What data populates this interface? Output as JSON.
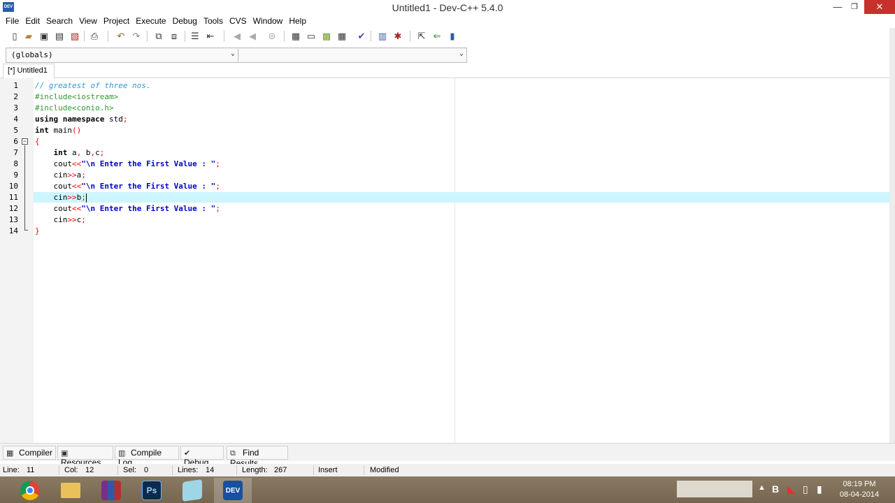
{
  "window": {
    "title": "Untitled1 - Dev-C++ 5.4.0",
    "minimize": "—",
    "maximize": "❐",
    "close": "✕",
    "app_icon_text": "DEV"
  },
  "menu": [
    "File",
    "Edit",
    "Search",
    "View",
    "Project",
    "Execute",
    "Debug",
    "Tools",
    "CVS",
    "Window",
    "Help"
  ],
  "toolbar": {
    "icons": [
      "new-file-icon",
      "open-file-icon",
      "save-icon",
      "save-all-icon",
      "close-file-icon",
      "print-icon",
      "undo-icon",
      "redo-icon",
      "find-icon",
      "replace-icon",
      "indent-icon",
      "unindent-icon",
      "goto-back-icon",
      "goto-forward-icon",
      "toggle-bookmark-icon",
      "compile-icon",
      "run-icon",
      "compile-run-icon",
      "rebuild-icon",
      "syntax-check-icon",
      "profile-icon",
      "debug-icon",
      "new-project-icon",
      "add-to-project-icon",
      "remove-from-project-icon"
    ]
  },
  "class_browser": {
    "scope_value": "(globals)",
    "member_value": ""
  },
  "editor_tabs": [
    {
      "label": "[*] Untitled1"
    }
  ],
  "editor": {
    "current_line": 11,
    "lines": [
      {
        "num": "1",
        "tokens": [
          {
            "t": "// greatest of three nos.",
            "c": "c-comment"
          }
        ]
      },
      {
        "num": "2",
        "tokens": [
          {
            "t": "#include<iostream>",
            "c": "c-pre"
          }
        ]
      },
      {
        "num": "3",
        "tokens": [
          {
            "t": "#include<conio.h>",
            "c": "c-pre"
          }
        ]
      },
      {
        "num": "4",
        "tokens": [
          {
            "t": "using namespace",
            "c": "c-kw"
          },
          {
            "t": " std",
            "c": "c-id"
          },
          {
            "t": ";",
            "c": "c-op"
          }
        ]
      },
      {
        "num": "5",
        "tokens": [
          {
            "t": "int",
            "c": "c-kw"
          },
          {
            "t": " main",
            "c": "c-id"
          },
          {
            "t": "()",
            "c": "c-op"
          }
        ]
      },
      {
        "num": "6",
        "tokens": [
          {
            "t": "{",
            "c": "c-op"
          }
        ]
      },
      {
        "num": "7",
        "tokens": [
          {
            "t": "    ",
            "c": "c-id"
          },
          {
            "t": "int",
            "c": "c-kw"
          },
          {
            "t": " a",
            "c": "c-id"
          },
          {
            "t": ",",
            "c": "c-op"
          },
          {
            "t": " b",
            "c": "c-id"
          },
          {
            "t": ",",
            "c": "c-op"
          },
          {
            "t": "c",
            "c": "c-id"
          },
          {
            "t": ";",
            "c": "c-op"
          }
        ]
      },
      {
        "num": "8",
        "tokens": [
          {
            "t": "    cout",
            "c": "c-id"
          },
          {
            "t": "<<",
            "c": "c-op"
          },
          {
            "t": "\"\\n Enter the First Value : \"",
            "c": "c-str"
          },
          {
            "t": ";",
            "c": "c-op"
          }
        ]
      },
      {
        "num": "9",
        "tokens": [
          {
            "t": "    cin",
            "c": "c-id"
          },
          {
            "t": ">>",
            "c": "c-op"
          },
          {
            "t": "a",
            "c": "c-id"
          },
          {
            "t": ";",
            "c": "c-op"
          }
        ]
      },
      {
        "num": "10",
        "tokens": [
          {
            "t": "    cout",
            "c": "c-id"
          },
          {
            "t": "<<",
            "c": "c-op"
          },
          {
            "t": "\"\\n Enter the First Value : \"",
            "c": "c-str"
          },
          {
            "t": ";",
            "c": "c-op"
          }
        ]
      },
      {
        "num": "11",
        "tokens": [
          {
            "t": "    cin",
            "c": "c-id"
          },
          {
            "t": ">>",
            "c": "c-op"
          },
          {
            "t": "b",
            "c": "c-id"
          },
          {
            "t": ";",
            "c": "c-op"
          }
        ]
      },
      {
        "num": "12",
        "tokens": [
          {
            "t": "    cout",
            "c": "c-id"
          },
          {
            "t": "<<",
            "c": "c-op"
          },
          {
            "t": "\"\\n Enter the First Value : \"",
            "c": "c-str"
          },
          {
            "t": ";",
            "c": "c-op"
          }
        ]
      },
      {
        "num": "13",
        "tokens": [
          {
            "t": "    cin",
            "c": "c-id"
          },
          {
            "t": ">>",
            "c": "c-op"
          },
          {
            "t": "c",
            "c": "c-id"
          },
          {
            "t": ";",
            "c": "c-op"
          }
        ]
      },
      {
        "num": "14",
        "tokens": [
          {
            "t": "}",
            "c": "c-op"
          }
        ]
      }
    ]
  },
  "bottom_tabs": [
    {
      "label": "Compiler",
      "icon": "compiler-icon"
    },
    {
      "label": "Resources",
      "icon": "resources-icon"
    },
    {
      "label": "Compile Log",
      "icon": "compile-log-icon"
    },
    {
      "label": "Debug",
      "icon": "debug-check-icon"
    },
    {
      "label": "Find Results",
      "icon": "find-results-icon"
    }
  ],
  "status": {
    "line_label": "Line:",
    "line_value": "11",
    "col_label": "Col:",
    "col_value": "12",
    "sel_label": "Sel:",
    "sel_value": "0",
    "lines_label": "Lines:",
    "lines_value": "14",
    "length_label": "Length:",
    "length_value": "267",
    "mode": "Insert",
    "state": "Modified"
  },
  "taskbar": {
    "apps": [
      "chrome-icon",
      "file-explorer-icon",
      "winrar-icon",
      "photoshop-icon",
      "notepad-icon",
      "devcpp-icon"
    ],
    "ps_text": "Ps",
    "dev_text": "DEV",
    "tray_icons": [
      "show-hidden-icon",
      "bluetooth-icon",
      "antivirus-icon",
      "power-icon",
      "network-icon",
      "volume-icon"
    ],
    "time": "08:19 PM",
    "date": "08-04-2014"
  }
}
